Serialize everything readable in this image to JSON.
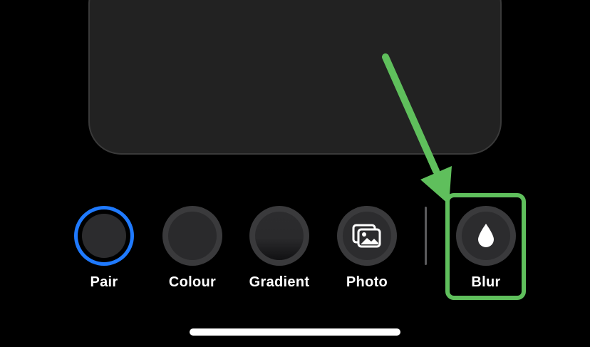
{
  "options": [
    {
      "id": "pair",
      "label": "Pair",
      "selected": true
    },
    {
      "id": "colour",
      "label": "Colour",
      "selected": false
    },
    {
      "id": "gradient",
      "label": "Gradient",
      "selected": false
    },
    {
      "id": "photo",
      "label": "Photo",
      "selected": false,
      "icon": "photos-icon"
    },
    {
      "id": "blur",
      "label": "Blur",
      "selected": false,
      "icon": "droplet-icon"
    }
  ],
  "colors": {
    "selected_ring": "#1f7aff",
    "annotation": "#5fbf5c",
    "background": "#000000",
    "card": "#222222"
  }
}
